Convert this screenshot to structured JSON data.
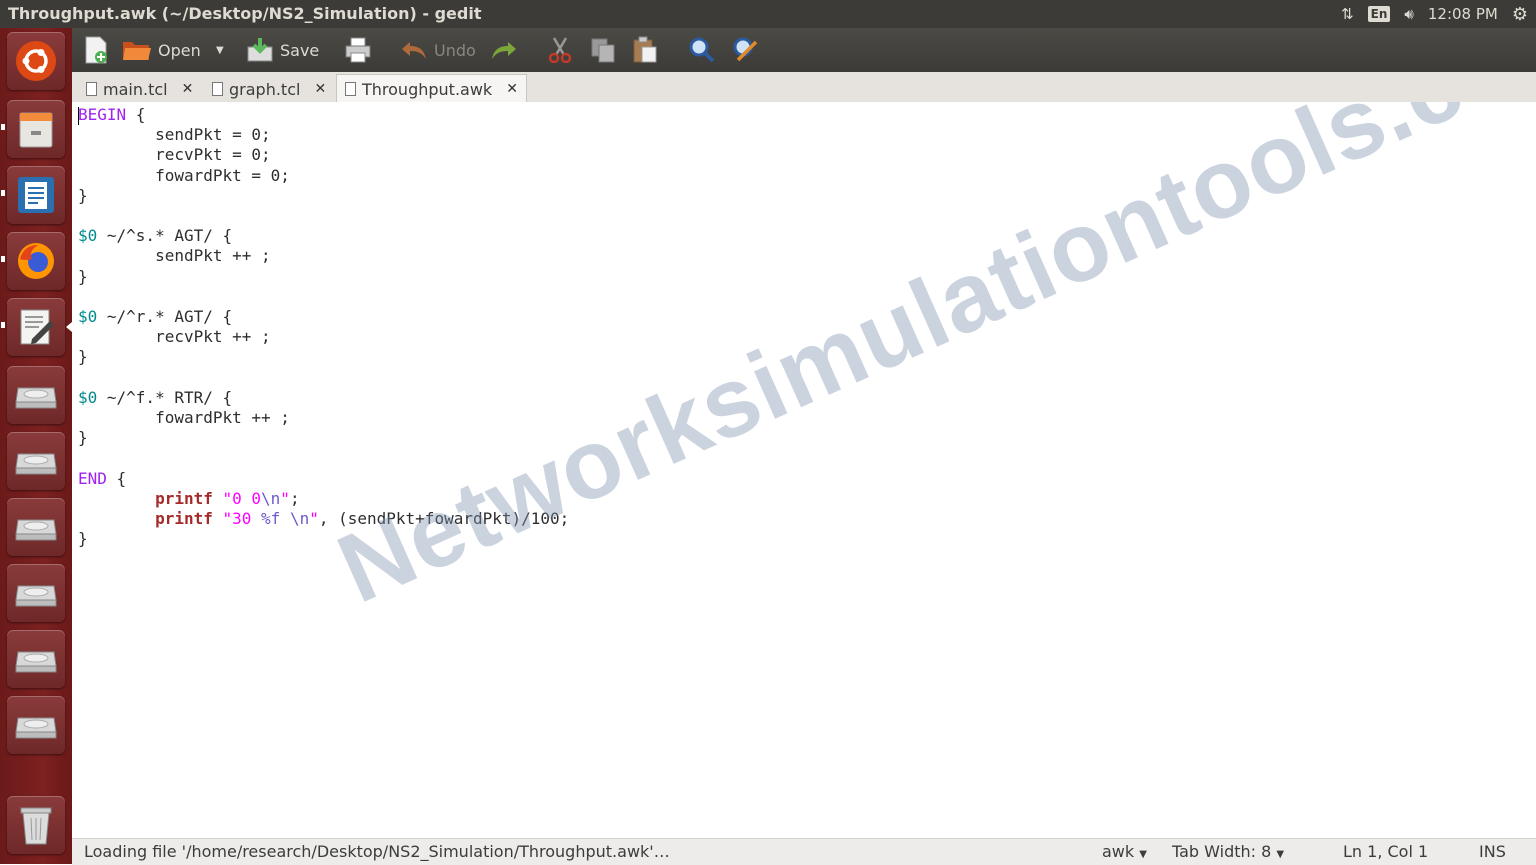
{
  "window": {
    "title": "Throughput.awk (~/Desktop/NS2_Simulation) - gedit"
  },
  "panel": {
    "lang": "En",
    "time": "12:08 PM"
  },
  "launcher": {
    "items": [
      "ubuntu-dash-icon",
      "files-icon",
      "libreoffice-writer-icon",
      "firefox-icon",
      "gedit-icon",
      "drive-icon",
      "drive-icon",
      "drive-icon",
      "drive-icon",
      "drive-icon",
      "drive-icon",
      "trash-icon"
    ]
  },
  "toolbar": {
    "open_label": "Open",
    "save_label": "Save",
    "undo_label": "Undo"
  },
  "tabs": [
    {
      "label": "main.tcl"
    },
    {
      "label": "graph.tcl"
    },
    {
      "label": "Throughput.awk"
    }
  ],
  "editor": {
    "lines": [
      "BEGIN {",
      "        sendPkt = 0;",
      "        recvPkt = 0;",
      "        fowardPkt = 0;",
      "}",
      "",
      "$0 ~/^s.* AGT/ {",
      "        sendPkt ++ ;",
      "}",
      "",
      "$0 ~/^r.* AGT/ {",
      "        recvPkt ++ ;",
      "}",
      "",
      "$0 ~/^f.* RTR/ {",
      "        fowardPkt ++ ;",
      "}",
      "",
      "END {",
      "        printf \"0 0\\n\";",
      "        printf \"30 %f \\n\", (sendPkt+fowardPkt)/100;",
      "}"
    ],
    "watermark": "Networksimulationtools.com"
  },
  "status": {
    "message": "Loading file '/home/research/Desktop/NS2_Simulation/Throughput.awk'…",
    "language": "awk",
    "tab_width": "Tab Width: 8",
    "position": "Ln 1, Col 1",
    "mode": "INS"
  }
}
